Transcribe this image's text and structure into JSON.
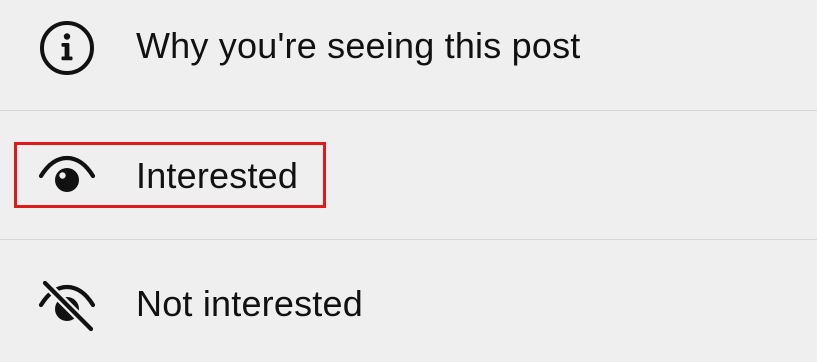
{
  "menu": {
    "items": [
      {
        "label": "Why you're seeing this post",
        "icon": "info-icon"
      },
      {
        "label": "Interested",
        "icon": "eye-icon"
      },
      {
        "label": "Not interested",
        "icon": "eye-slash-icon"
      }
    ]
  },
  "annotation": {
    "highlight_color": "#e01a1a",
    "highlighted_item": "Interested"
  }
}
